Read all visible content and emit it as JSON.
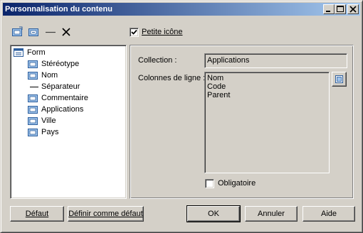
{
  "window": {
    "title": "Personnalisation du contenu"
  },
  "toolbar": {
    "icons": [
      "add-item-icon",
      "add-sub-item-icon",
      "separator-icon",
      "delete-icon"
    ]
  },
  "options": {
    "small_icon_label": "Petite icône",
    "small_icon_checked": true
  },
  "tree": {
    "root": "Form",
    "items": [
      {
        "label": "Stéréotype",
        "icon": "attribute-icon"
      },
      {
        "label": "Nom",
        "icon": "attribute-icon"
      },
      {
        "label": "Séparateur",
        "icon": "separator-line-icon"
      },
      {
        "label": "Commentaire",
        "icon": "attribute-icon"
      },
      {
        "label": "Applications",
        "icon": "attribute-icon"
      },
      {
        "label": "Ville",
        "icon": "attribute-icon"
      },
      {
        "label": "Pays",
        "icon": "attribute-icon"
      }
    ]
  },
  "props": {
    "collection_label": "Collection :",
    "collection_value": "Applications",
    "columns_label": "Colonnes de ligne :",
    "columns": [
      "Nom",
      "Code",
      "Parent"
    ],
    "required_label": "Obligatoire",
    "required_checked": false
  },
  "buttons": {
    "default_label": "Défaut",
    "set_default_label": "Définir comme défaut",
    "ok_label": "OK",
    "cancel_label": "Annuler",
    "help_label": "Aide"
  }
}
